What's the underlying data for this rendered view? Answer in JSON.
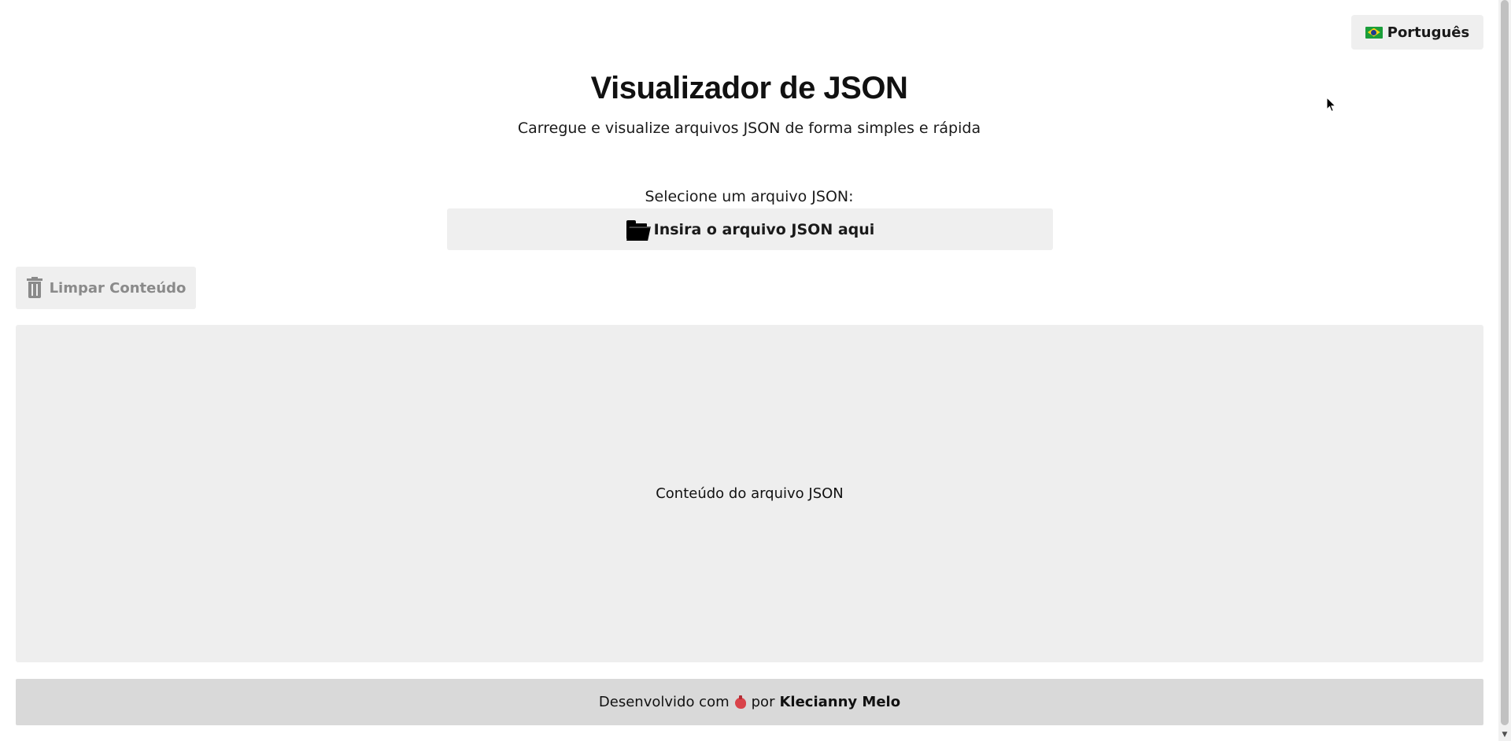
{
  "language_selector": {
    "label": "Português"
  },
  "header": {
    "title": "Visualizador de JSON",
    "subtitle": "Carregue e visualize arquivos JSON de forma simples e rápida"
  },
  "upload": {
    "label": "Selecione um arquivo JSON:",
    "button_label": "Insira o arquivo JSON aqui"
  },
  "actions": {
    "clear_label": "Limpar Conteúdo"
  },
  "content": {
    "placeholder": "Conteúdo do arquivo JSON"
  },
  "footer": {
    "prefix": "Desenvolvido com",
    "by": "por",
    "author": "Klecianny Melo"
  },
  "icons": {
    "language": "brazil-flag-icon",
    "upload": "folder-icon",
    "clear": "trash-icon",
    "footer": "anatomical-heart-icon"
  },
  "colors": {
    "button_bg": "#efefef",
    "content_bg": "#eeeeee",
    "footer_bg": "#d9d9d9",
    "disabled_text": "#8a8a8a"
  }
}
